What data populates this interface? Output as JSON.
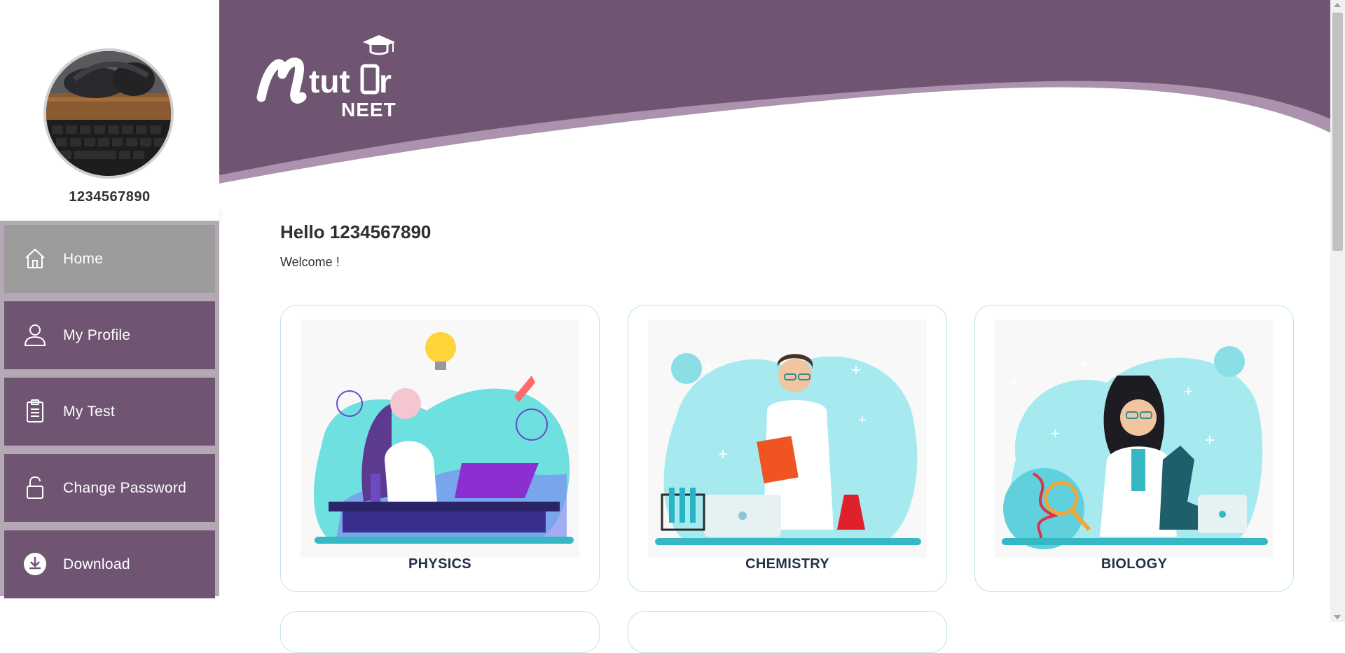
{
  "user": {
    "name": "1234567890",
    "avatar_icon": "headphones-keyboard-photo"
  },
  "sidebar": {
    "items": [
      {
        "label": "Home",
        "icon": "home-icon",
        "active": true
      },
      {
        "label": "My Profile",
        "icon": "user-icon",
        "active": false
      },
      {
        "label": "My Test",
        "icon": "clipboard-icon",
        "active": false
      },
      {
        "label": "Change Password",
        "icon": "lock-icon",
        "active": false
      },
      {
        "label": "Download",
        "icon": "download-icon",
        "active": false
      }
    ]
  },
  "header": {
    "brand": "Mtutor",
    "subbrand": "NEET"
  },
  "main": {
    "greeting": "Hello 1234567890",
    "welcome": "Welcome !",
    "subjects": [
      {
        "label": "PHYSICS",
        "illustration": "physics-illustration"
      },
      {
        "label": "CHEMISTRY",
        "illustration": "chemistry-illustration"
      },
      {
        "label": "BIOLOGY",
        "illustration": "biology-illustration"
      }
    ]
  },
  "colors": {
    "primary": "#6f5571",
    "menu_bg": "#b4a8b4",
    "active": "#9b9b9b",
    "wave_light": "#ab93ad",
    "card_border": "#bfe3ec",
    "accent_teal": "#5fd0dc"
  }
}
